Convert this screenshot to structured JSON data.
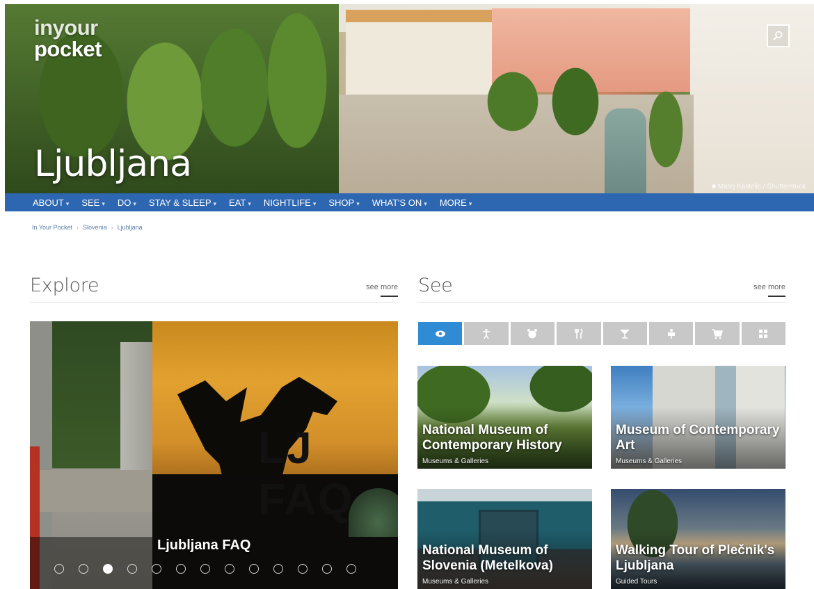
{
  "header": {
    "logo_line1": "inyour",
    "logo_line2": "pocket",
    "city": "Ljubljana",
    "photo_credit": "Matej Kastelic / Shutterstock",
    "search_icon": "search-icon"
  },
  "nav": {
    "items": [
      {
        "label": "ABOUT"
      },
      {
        "label": "SEE"
      },
      {
        "label": "DO"
      },
      {
        "label": "STAY & SLEEP"
      },
      {
        "label": "EAT"
      },
      {
        "label": "NIGHTLIFE"
      },
      {
        "label": "SHOP"
      },
      {
        "label": "WHAT'S ON"
      },
      {
        "label": "MORE"
      }
    ],
    "caret": "▾"
  },
  "breadcrumb": [
    "In Your Pocket",
    "Slovenia",
    "Ljubljana"
  ],
  "explore": {
    "title": "Explore",
    "see_more_prefix": "see ",
    "see_more_link": "more",
    "slide_logo_text": "LJ FAQ",
    "slide_caption": "Ljubljana FAQ",
    "dot_count": 13,
    "active_dot": 3
  },
  "see": {
    "title": "See",
    "see_more_prefix": "see ",
    "see_more_link": "more",
    "tabs": [
      {
        "icon": "eye-icon",
        "active": true
      },
      {
        "icon": "person-icon",
        "active": false
      },
      {
        "icon": "alarm-clock-icon",
        "active": false
      },
      {
        "icon": "fork-knife-icon",
        "active": false
      },
      {
        "icon": "cocktail-glass-icon",
        "active": false
      },
      {
        "icon": "bed-icon",
        "active": false
      },
      {
        "icon": "shopping-cart-icon",
        "active": false
      },
      {
        "icon": "grid-icon",
        "active": false
      }
    ],
    "cards": [
      {
        "title": "National Museum of Contemporary History",
        "category": "Museums & Galleries"
      },
      {
        "title": "Museum of Contemporary Art",
        "category": "Museums & Galleries"
      },
      {
        "title": "National Museum of Slovenia (Metelkova)",
        "category": "Museums & Galleries"
      },
      {
        "title": "Walking Tour of Plečnik's Ljubljana",
        "category": "Guided Tours"
      }
    ]
  },
  "colors": {
    "nav_bg": "#2d66b1",
    "active_tab": "#2f8bd4",
    "inactive_tab": "#c8c8c8",
    "link": "#5a7ea8"
  }
}
